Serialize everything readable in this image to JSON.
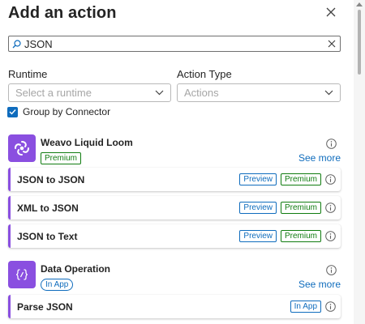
{
  "panel": {
    "title": "Add an action",
    "close_icon": "close-icon"
  },
  "search": {
    "value": "JSON",
    "placeholder": ""
  },
  "filters": {
    "runtime_label": "Runtime",
    "runtime_placeholder": "Select a runtime",
    "action_type_label": "Action Type",
    "action_type_placeholder": "Actions"
  },
  "group_by": {
    "label": "Group by Connector",
    "checked": true
  },
  "connectors": [
    {
      "name": "Weavo Liquid Loom",
      "badge": "Premium",
      "see_more": "See more",
      "icon": "swirl-icon",
      "icon_color": "#8a4fe0",
      "actions": [
        {
          "name": "JSON to JSON",
          "badges": [
            "Preview",
            "Premium"
          ]
        },
        {
          "name": "XML to JSON",
          "badges": [
            "Preview",
            "Premium"
          ]
        },
        {
          "name": "JSON to Text",
          "badges": [
            "Preview",
            "Premium"
          ]
        }
      ]
    },
    {
      "name": "Data Operation",
      "badge": "In App",
      "see_more": "See more",
      "icon": "curly-braces-icon",
      "icon_color": "#8a4fe0",
      "actions": [
        {
          "name": "Parse JSON",
          "badges": [
            "In App"
          ]
        }
      ]
    }
  ],
  "colors": {
    "accent": "#0f6cbd",
    "premium": "#107c10",
    "connector_purple": "#8a4fe0"
  }
}
